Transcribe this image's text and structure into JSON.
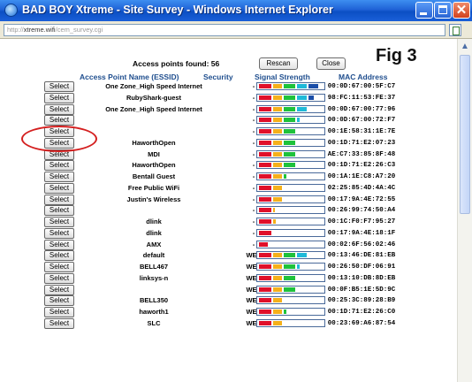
{
  "window": {
    "title": "BAD BOY Xtreme - Site Survey - Windows Internet Explorer",
    "url_prefix": "http://",
    "url_host": "xtreme.wifi",
    "url_path": "/cem_survey.cgi"
  },
  "page": {
    "access_points_found_label": "Access points found: 56",
    "rescan_label": "Rescan",
    "close_label": "Close",
    "figure_label": "Fig 3"
  },
  "table": {
    "headers": [
      "Access Point Name (ESSID)",
      "Security",
      "Signal Strength",
      "MAC Address"
    ],
    "select_label": "Select",
    "signal_colors": [
      "#e0102a",
      "#f5b01a",
      "#1ec23b",
      "#1fb9d8",
      "#1a4ea8"
    ],
    "rows": [
      {
        "essid": "One Zone_High Speed Internet",
        "security": "-",
        "signal": 5,
        "mac": "00:0D:67:00:5F:C7"
      },
      {
        "essid": "RubyShark-guest",
        "security": "-",
        "signal": 4.5,
        "mac": "98:FC:11:53:FE:37"
      },
      {
        "essid": "One Zone_High Speed Internet",
        "security": "-",
        "signal": 4,
        "mac": "00:0D:67:00:77:96"
      },
      {
        "essid": "",
        "security": "-",
        "signal": 3.3,
        "mac": "00:0D:67:00:72:F7"
      },
      {
        "essid": "",
        "security": "-",
        "signal": 3,
        "mac": "00:1E:58:31:1E:7E"
      },
      {
        "essid": "HaworthOpen",
        "security": "-",
        "signal": 3,
        "mac": "00:1D:71:E2:07:23"
      },
      {
        "essid": "MDI",
        "security": "-",
        "signal": 3,
        "mac": "AE:C7:33:85:8F:48"
      },
      {
        "essid": "HaworthOpen",
        "security": "-",
        "signal": 3,
        "mac": "00:1D:71:E2:26:C3"
      },
      {
        "essid": "Bentall Guest",
        "security": "-",
        "signal": 2.2,
        "mac": "00:1A:1E:C8:A7:20"
      },
      {
        "essid": "Free Public WiFi",
        "security": "-",
        "signal": 2,
        "mac": "02:25:85:4D:4A:4C"
      },
      {
        "essid": "Justin's Wireless",
        "security": "-",
        "signal": 2,
        "mac": "00:17:9A:4E:72:55"
      },
      {
        "essid": "",
        "security": "-",
        "signal": 1.2,
        "mac": "00:26:99:74:50:A4"
      },
      {
        "essid": "dlink",
        "security": "-",
        "signal": 1.3,
        "mac": "00:1C:F0:F7:95:27"
      },
      {
        "essid": "dlink",
        "security": "-",
        "signal": 1,
        "mac": "00:17:9A:4E:18:1F"
      },
      {
        "essid": "AMX",
        "security": "-",
        "signal": 0.7,
        "mac": "00:02:6F:56:02:46"
      },
      {
        "essid": "default",
        "security": "WEP",
        "signal": 4,
        "mac": "00:13:46:DE:81:EB"
      },
      {
        "essid": "BELL467",
        "security": "WEP",
        "signal": 3.3,
        "mac": "00:26:50:DF:06:91"
      },
      {
        "essid": "linksys-n",
        "security": "WEP",
        "signal": 3,
        "mac": "00:13:10:DB:8D:EB"
      },
      {
        "essid": "",
        "security": "WEP",
        "signal": 3,
        "mac": "00:0F:B5:1E:5D:9C"
      },
      {
        "essid": "BELL350",
        "security": "WEP",
        "signal": 2,
        "mac": "00:25:3C:89:28:B9"
      },
      {
        "essid": "haworth1",
        "security": "WEP",
        "signal": 2.2,
        "mac": "00:1D:71:E2:26:C0"
      },
      {
        "essid": "SLC",
        "security": "WEP",
        "signal": 2,
        "mac": "00:23:69:A6:87:54"
      }
    ]
  }
}
